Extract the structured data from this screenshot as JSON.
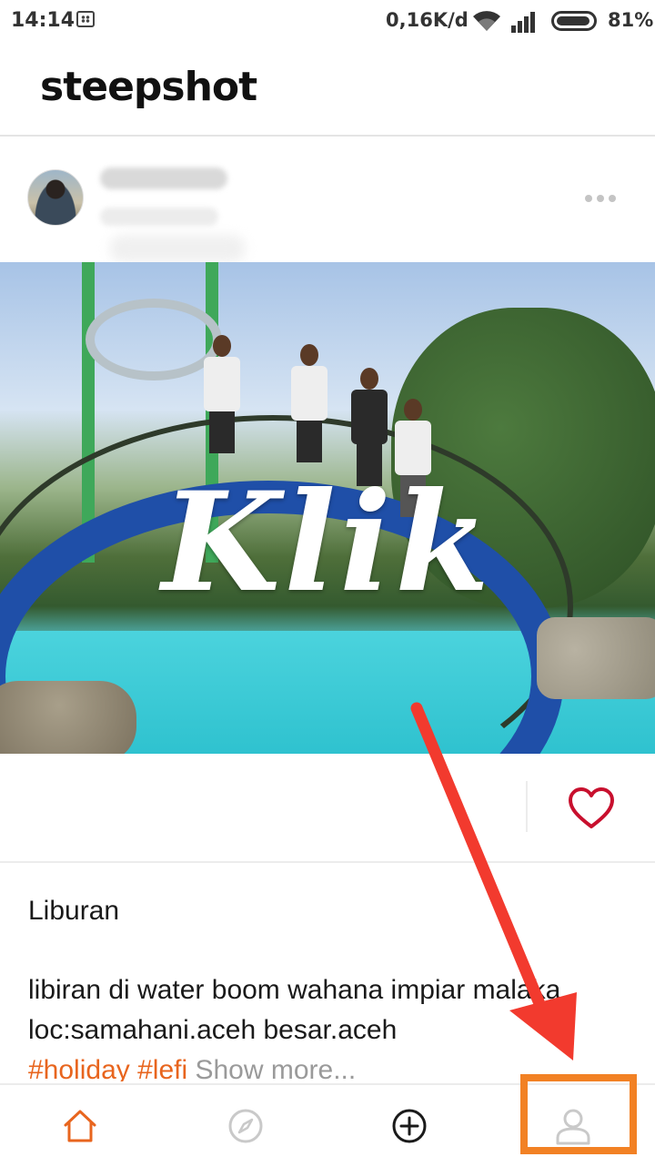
{
  "status_bar": {
    "time": "14:14",
    "network_speed": "0,16K/d",
    "battery": "81%"
  },
  "app": {
    "logo": "steepshot"
  },
  "post": {
    "author": "",
    "time": "",
    "image_overlay_text": "Klik",
    "liked": false,
    "title": "Liburan",
    "body": "libiran di water boom wahana impiar malaka loc:samahani.aceh besar.aceh",
    "hashtags": "#holiday #lefi",
    "show_more": "Show more..."
  },
  "nav": {
    "items": [
      {
        "name": "home",
        "icon": "home-icon",
        "active": true
      },
      {
        "name": "explore",
        "icon": "compass-icon",
        "active": false
      },
      {
        "name": "create",
        "icon": "plus-circle-icon",
        "active": false
      },
      {
        "name": "profile",
        "icon": "user-icon",
        "active": false
      }
    ]
  },
  "colors": {
    "accent": "#e8651e",
    "like": "#c8102e",
    "annotation": "#f28124",
    "arrow": "#f23a2e"
  }
}
